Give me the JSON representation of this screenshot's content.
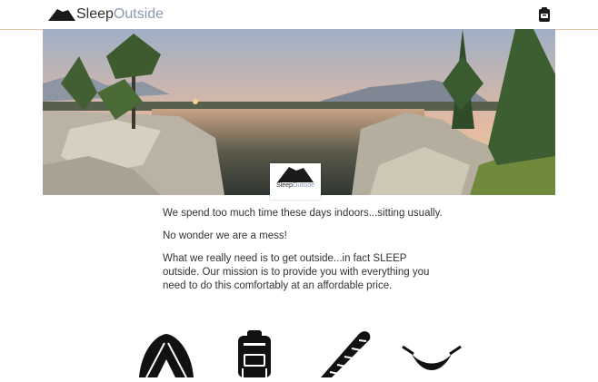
{
  "header": {
    "logo": {
      "text_primary": "Sleep",
      "text_secondary": "Outside"
    },
    "cart_icon": "backpack-cart-icon"
  },
  "hero": {
    "image": "mountain-lake-panorama",
    "badge": {
      "text_primary": "Sleep",
      "text_secondary": "Outside"
    }
  },
  "intro": {
    "paragraphs": [
      "We spend too much time these days indoors...sitting usually.",
      "No wonder we are a mess!",
      "What we really need is to get outside...in fact SLEEP outside. Our mission is to provide you with everything you need to do this comfortably at an affordable price."
    ]
  },
  "products": [
    {
      "icon": "tent-icon"
    },
    {
      "icon": "backpack-icon"
    },
    {
      "icon": "sleeping-bag-icon"
    },
    {
      "icon": "hammock-icon"
    }
  ],
  "colors": {
    "accent": "#8a9bb3",
    "header_border": "#e3c9a8",
    "text": "#333333"
  }
}
